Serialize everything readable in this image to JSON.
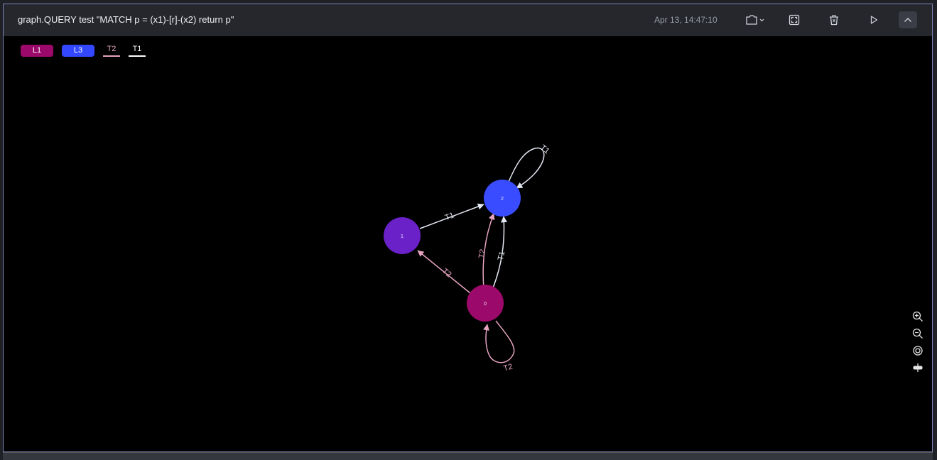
{
  "header": {
    "query": "graph.QUERY test \"MATCH p = (x1)-[r]-(x2) return p\"",
    "timestamp": "Apr 13, 14:47:10"
  },
  "legend": {
    "labels": [
      {
        "name": "L1",
        "color": "#9b0a6a"
      },
      {
        "name": "L3",
        "color": "#3347ff"
      }
    ],
    "relations": [
      {
        "name": "T2",
        "color": "#e6a3c0"
      },
      {
        "name": "T1",
        "color": "#e4e8f2"
      }
    ]
  },
  "graph": {
    "nodes": [
      {
        "id": "0",
        "color": "#9b0a6a"
      },
      {
        "id": "1",
        "color": "#6b21c8"
      },
      {
        "id": "2",
        "color": "#3a4cff"
      }
    ],
    "edges": [
      {
        "label": "T1",
        "from": "1",
        "to": "2"
      },
      {
        "label": "T1",
        "from": "2",
        "to": "2"
      },
      {
        "label": "T2",
        "from": "0",
        "to": "1"
      },
      {
        "label": "T2",
        "from": "0",
        "to": "2"
      },
      {
        "label": "T1",
        "from": "0",
        "to": "2"
      },
      {
        "label": "T2",
        "from": "0",
        "to": "0"
      }
    ]
  },
  "icons": {
    "toolbar": [
      "snapshot-icon",
      "fullscreen-icon",
      "delete-icon",
      "run-icon",
      "collapse-icon"
    ],
    "zoom": [
      "zoom-in-icon",
      "zoom-out-icon",
      "center-icon",
      "layout-icon"
    ]
  }
}
